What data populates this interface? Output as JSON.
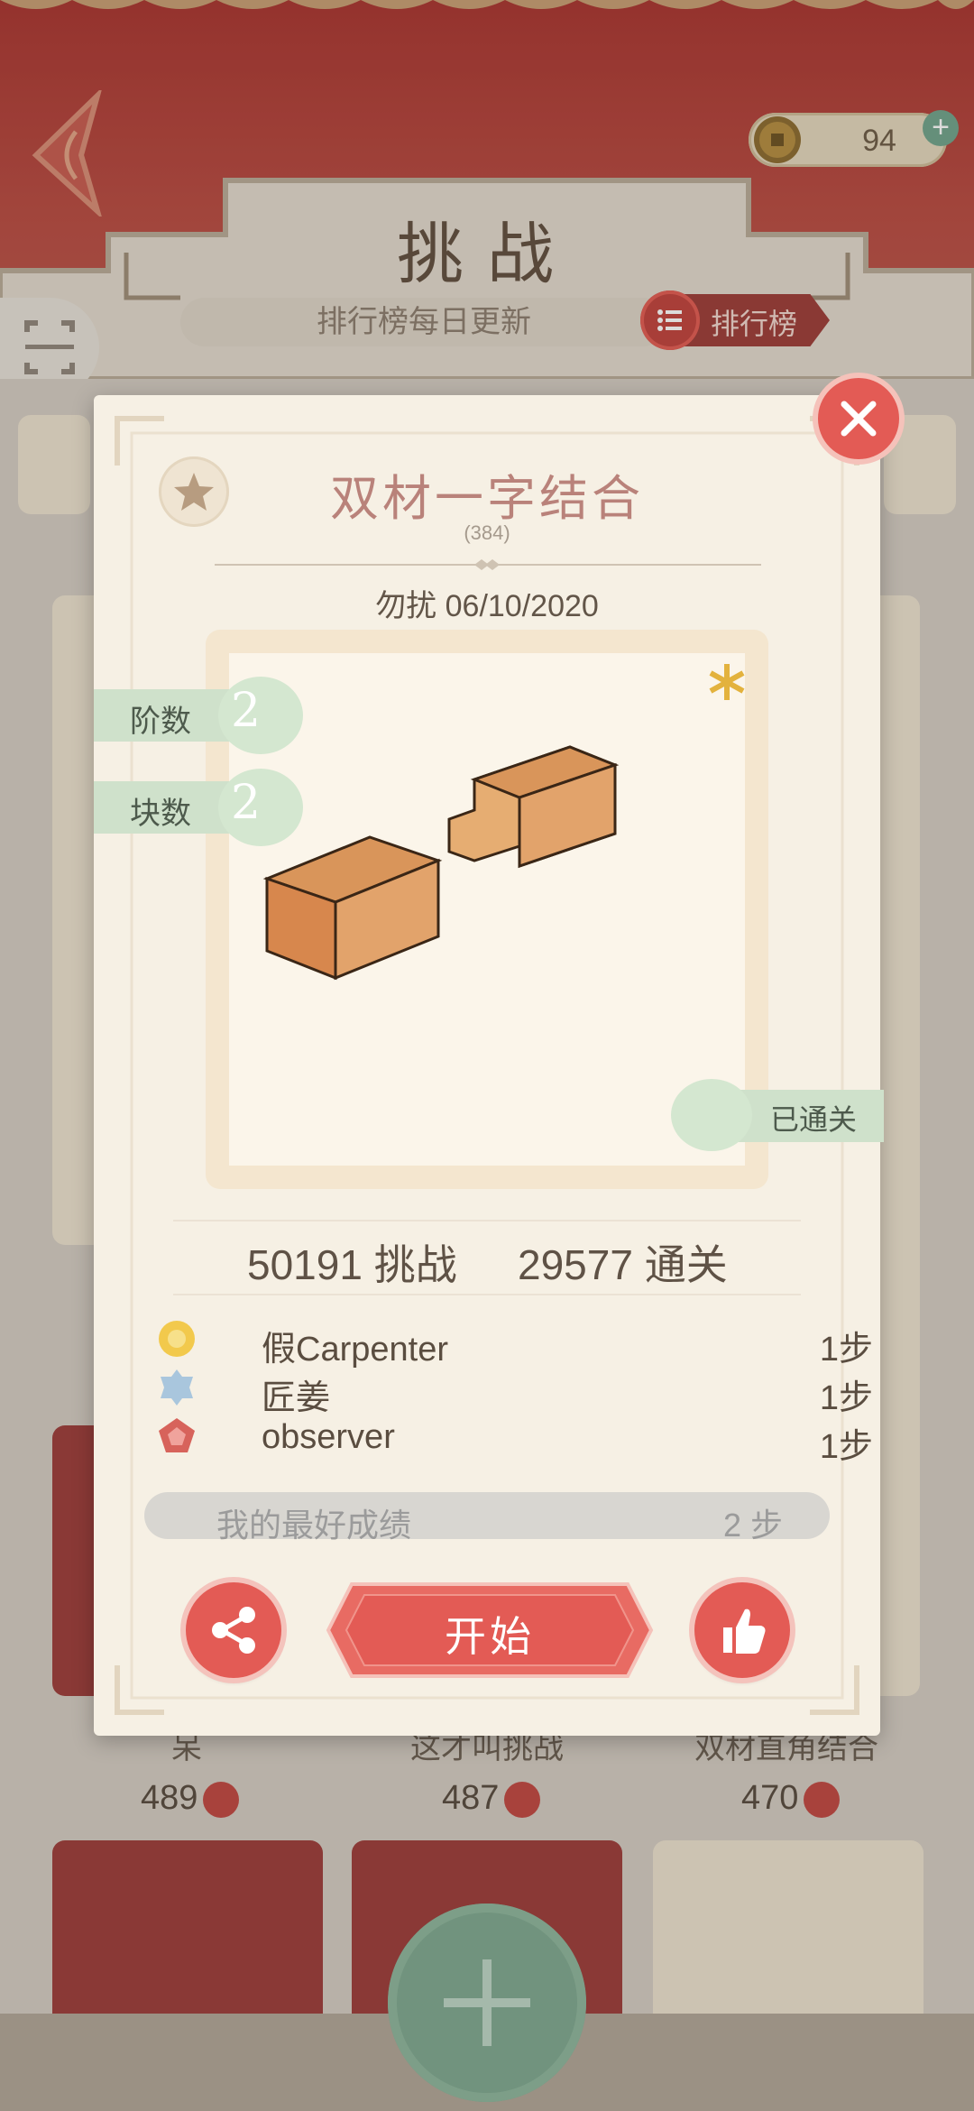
{
  "header": {
    "title": "挑战",
    "rank_info": "排行榜每日更新",
    "rank_button_label": "排行榜",
    "coins": "94",
    "coin_add_label": "+"
  },
  "background_grid": {
    "captions": [
      "呆",
      "这才叫挑战",
      "双材直角结合"
    ],
    "likes": [
      "489",
      "487",
      "470"
    ]
  },
  "dialog": {
    "title": "双材一字结合",
    "puzzle_id": "(384)",
    "author_line": "勿扰  06/10/2020",
    "tags": {
      "order_label": "阶数",
      "order_value": "2",
      "pieces_label": "块数",
      "pieces_value": "2",
      "cleared_label": "已通关"
    },
    "stats": {
      "challenges": "50191 挑战",
      "cleared": "29577 通关"
    },
    "leaderboard": [
      {
        "name": "假Carpenter",
        "steps": "1步",
        "medal_color": "#f2c94c"
      },
      {
        "name": "匠姜",
        "steps": "1步",
        "medal_color": "#a9c6dd"
      },
      {
        "name": "observer",
        "steps": "1步",
        "medal_color": "#d7635b"
      }
    ],
    "best": {
      "label": "我的最好成绩",
      "value": "2 步"
    },
    "start_label": "开始"
  },
  "colors": {
    "header_red": "#a8322d",
    "accent_red": "#e35b55",
    "jade": "#7da88f",
    "paper": "#f6f0e4"
  }
}
